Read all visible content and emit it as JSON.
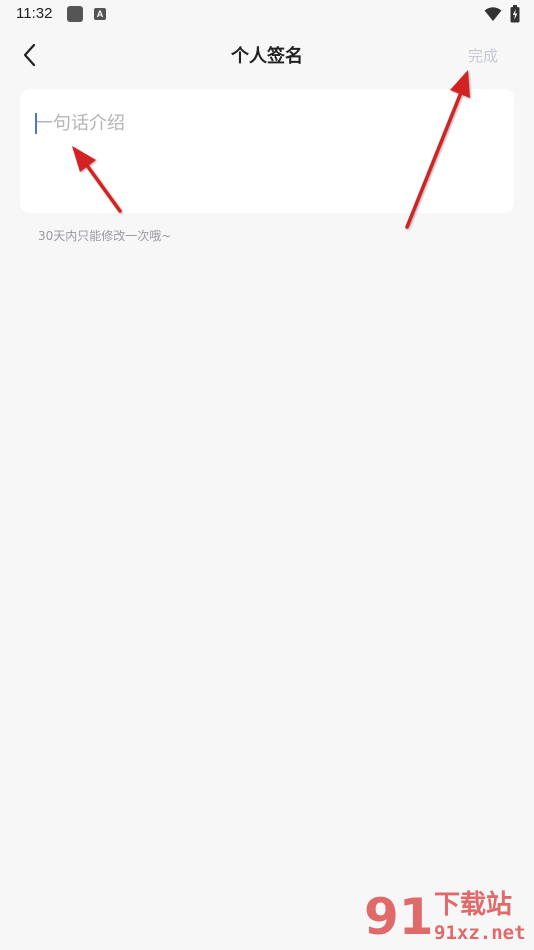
{
  "status_bar": {
    "time": "11:32",
    "notif_letter": "A"
  },
  "header": {
    "title": "个人签名",
    "done_label": "完成"
  },
  "signature": {
    "placeholder": "一句话介绍",
    "value": ""
  },
  "hint": "30天内只能修改一次哦~",
  "watermark": {
    "nine": "91",
    "cn": "下载站",
    "en": "91xz.net"
  },
  "colors": {
    "background": "#f7f7f8",
    "card": "#ffffff",
    "done_disabled": "#c7c9d6",
    "annotation_arrow": "#d32020",
    "watermark": "#e06a6a"
  }
}
